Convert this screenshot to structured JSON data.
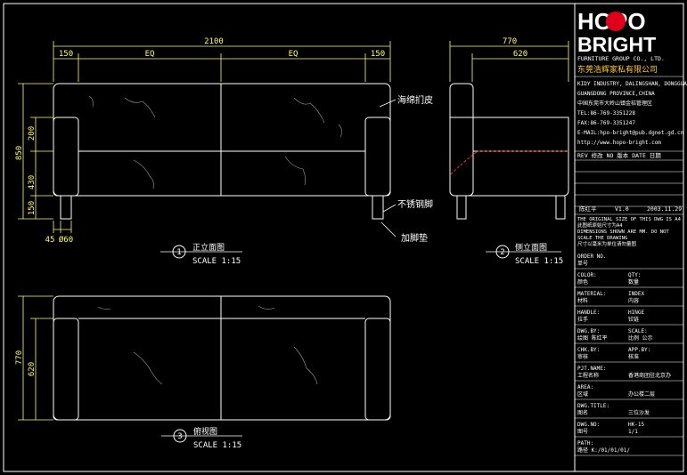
{
  "drawing": {
    "front_view": {
      "dims_top": {
        "total": "2100",
        "left": "150",
        "mid_left": "EQ",
        "mid_right": "EQ",
        "right": "150"
      },
      "dims_left": {
        "d200": "200",
        "d850": "850",
        "d430": "430",
        "d150": "150"
      },
      "dims_bottom": {
        "d45": "45",
        "d60": "Ø60"
      },
      "callouts": {
        "leather": "海绵扪皮",
        "steel": "不锈钢脚",
        "pad": "加脚垫"
      },
      "title": {
        "num": "1",
        "name": "正立面图",
        "scale": "SCALE 1:15"
      }
    },
    "side_view": {
      "dims_top": {
        "d770": "770",
        "d620": "620"
      },
      "title": {
        "num": "2",
        "name": "侧立面图",
        "scale": "SCALE 1:15"
      }
    },
    "plan_view": {
      "dims_left": {
        "d770": "770",
        "d620": "620"
      },
      "title": {
        "num": "3",
        "name": "俯视图",
        "scale": "SCALE 1:15"
      }
    }
  },
  "title_block": {
    "logo_line1": "HOPO",
    "logo_line2": "BRIGHT",
    "subtitle": "FURNITURE GROUP CO., LTD.",
    "company_cn": "东莞浩辉家私有限公司",
    "address_lines": [
      "KIDY INDUSTRY, DALINGSHAN, DONGGUAN",
      "GUANGDONG PROVINCE,CHINA",
      "中国东莞市大岭山镇金桔管理区",
      "TEL:86-769-3351228",
      "FAX:86-769-3351247",
      "E-MAIL:hpo-bright@pub.dgnet.gd.cn",
      "http://www.hopo-bright.com"
    ],
    "rev_header": "REV 修改   NO 版本   DATE 日期",
    "rev_row": {
      "who": "陈红平",
      "ver": "V1.0",
      "date": "2003.11.29"
    },
    "notes": [
      "THE ORIGINAL SIZE OF THIS DWG IS A4",
      "此图纸原始尺寸为A4",
      "DIMENSIONS SHOWN ARE MM. DO NOT",
      "SCALE THE DRAWING",
      "尺寸以毫米为单位请勿量图"
    ],
    "fields": [
      {
        "en": "ORDER NO.",
        "cn": "单号",
        "val": ""
      },
      {
        "en": "COLOR:",
        "cn": "颜色",
        "val": "QTY:",
        "val2": "数量"
      },
      {
        "en": "MATERIAL:",
        "cn": "材料",
        "val": "INDEX",
        "val2": "内容"
      },
      {
        "en": "HANDLE:",
        "cn": "拉手",
        "val": "HINGE",
        "val2": "铰链"
      },
      {
        "en": "DWG.BY:",
        "cn": "绘图  陈红平",
        "val": "SCALE:",
        "val2": "比例 公示"
      },
      {
        "en": "CHK.BY:",
        "cn": "审核",
        "val": "APP.BY:",
        "val2": "核准"
      },
      {
        "en": "PJT.NAME:",
        "cn": "工程名称",
        "val": "香港商团驻北京办",
        "val2": ""
      },
      {
        "en": "AREA:",
        "cn": "区域",
        "val": "办公楼二层",
        "val2": ""
      },
      {
        "en": "DWG.TITLE:",
        "cn": "图名",
        "val": "三位沙发",
        "val2": ""
      },
      {
        "en": "DWG.NO:",
        "cn": "图号",
        "val": "HK-15",
        "val2": "1/1"
      },
      {
        "en": "PATH:",
        "cn": "路径 K:/01/01/01/",
        "val": "",
        "val2": ""
      }
    ]
  }
}
